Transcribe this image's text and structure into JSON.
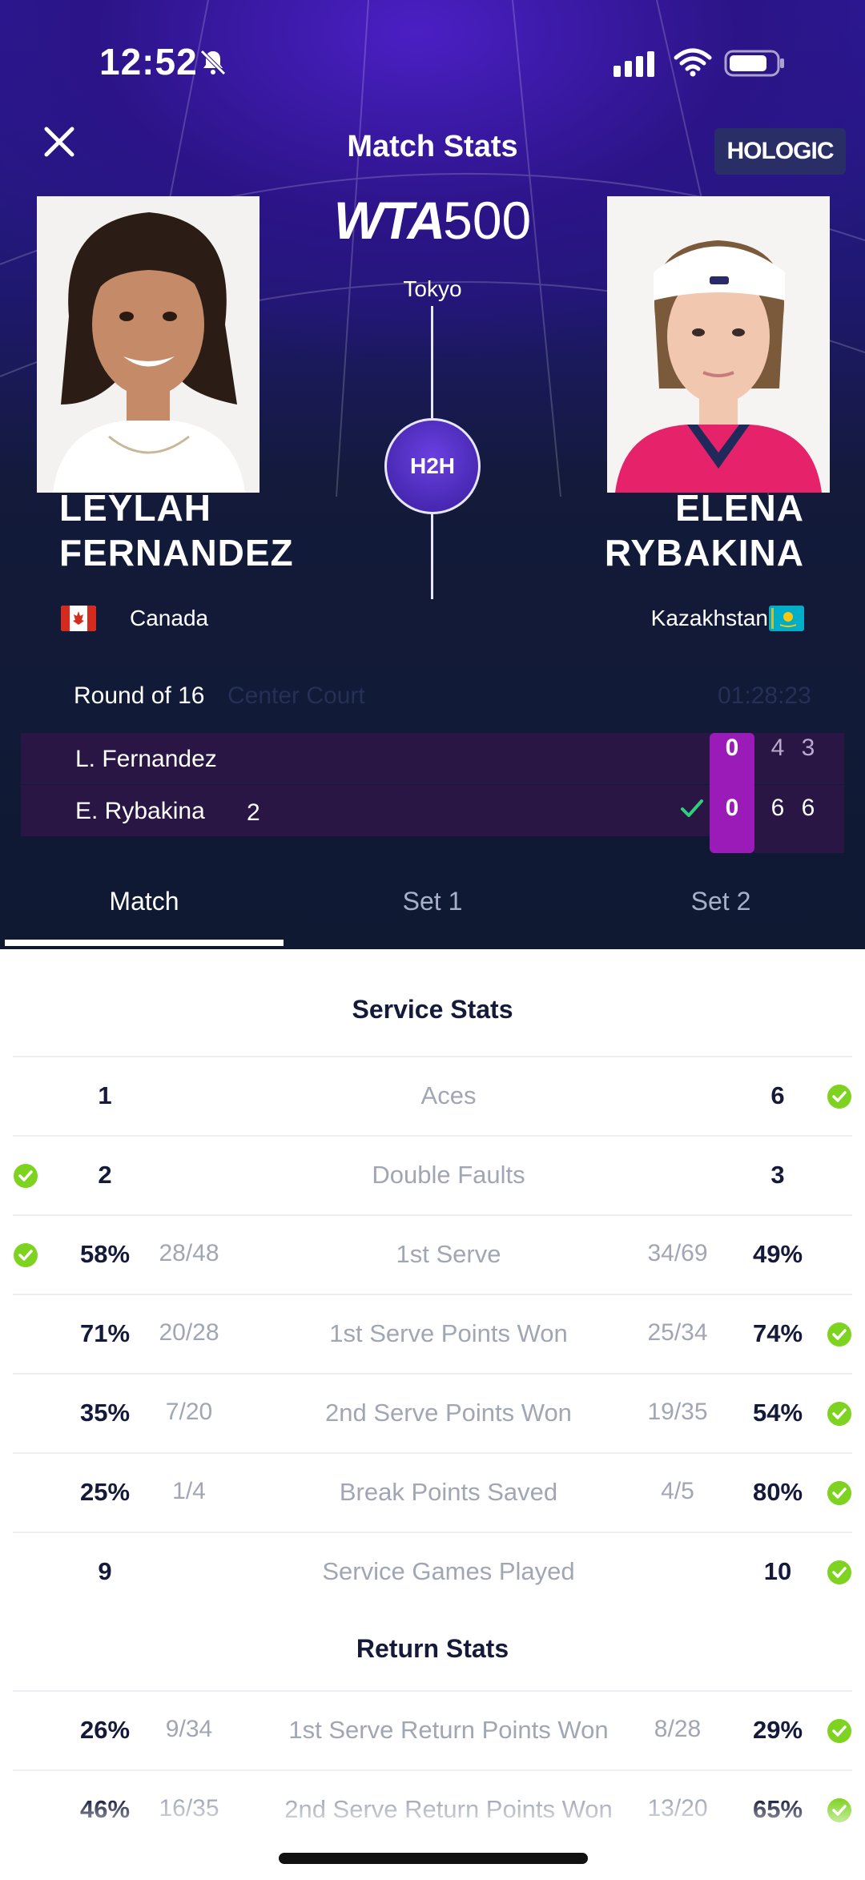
{
  "status_bar": {
    "time": "12:52"
  },
  "header": {
    "title": "Match Stats",
    "sponsor": "HOLOGIC"
  },
  "event": {
    "brand": "WTA",
    "level": "500",
    "city": "Tokyo",
    "h2h_label": "H2H"
  },
  "players": {
    "left": {
      "first": "LEYLAH",
      "last": "FERNANDEZ",
      "country": "Canada",
      "flag": "canada-flag"
    },
    "right": {
      "first": "ELENA",
      "last": "RYBAKINA",
      "country": "Kazakhstan",
      "flag": "kazakhstan-flag"
    }
  },
  "match": {
    "round": "Round of 16",
    "court": "Center Court",
    "duration": "01:28:23",
    "rows": [
      {
        "name": "L. Fernandez",
        "seed": "",
        "game": "0",
        "sets": [
          "4",
          "3"
        ],
        "winner": false
      },
      {
        "name": "E. Rybakina",
        "seed": "2",
        "game": "0",
        "sets": [
          "6",
          "6"
        ],
        "winner": true
      }
    ]
  },
  "tabs": [
    {
      "label": "Match",
      "active": true
    },
    {
      "label": "Set 1",
      "active": false
    },
    {
      "label": "Set 2",
      "active": false
    }
  ],
  "service_stats": {
    "title": "Service Stats",
    "rows": [
      {
        "label": "Aces",
        "left": "1",
        "left_frac": "",
        "right_frac": "",
        "right": "6",
        "leader": "right"
      },
      {
        "label": "Double Faults",
        "left": "2",
        "left_frac": "",
        "right_frac": "",
        "right": "3",
        "leader": "left"
      },
      {
        "label": "1st Serve",
        "left": "58%",
        "left_frac": "28/48",
        "right_frac": "34/69",
        "right": "49%",
        "leader": "left"
      },
      {
        "label": "1st Serve Points Won",
        "left": "71%",
        "left_frac": "20/28",
        "right_frac": "25/34",
        "right": "74%",
        "leader": "right"
      },
      {
        "label": "2nd Serve Points Won",
        "left": "35%",
        "left_frac": "7/20",
        "right_frac": "19/35",
        "right": "54%",
        "leader": "right"
      },
      {
        "label": "Break Points Saved",
        "left": "25%",
        "left_frac": "1/4",
        "right_frac": "4/5",
        "right": "80%",
        "leader": "right"
      },
      {
        "label": "Service Games Played",
        "left": "9",
        "left_frac": "",
        "right_frac": "",
        "right": "10",
        "leader": "right"
      }
    ]
  },
  "return_stats": {
    "title": "Return Stats",
    "rows": [
      {
        "label": "1st Serve Return Points Won",
        "left": "26%",
        "left_frac": "9/34",
        "right_frac": "8/28",
        "right": "29%",
        "leader": "right"
      },
      {
        "label": "2nd Serve Return Points Won",
        "left": "46%",
        "left_frac": "16/35",
        "right_frac": "13/20",
        "right": "65%",
        "leader": "right"
      }
    ]
  },
  "colors": {
    "accent": "#9b1bb8",
    "check": "#7ed321",
    "hero_dark": "#0f1932",
    "score_row": "#2a1645"
  }
}
